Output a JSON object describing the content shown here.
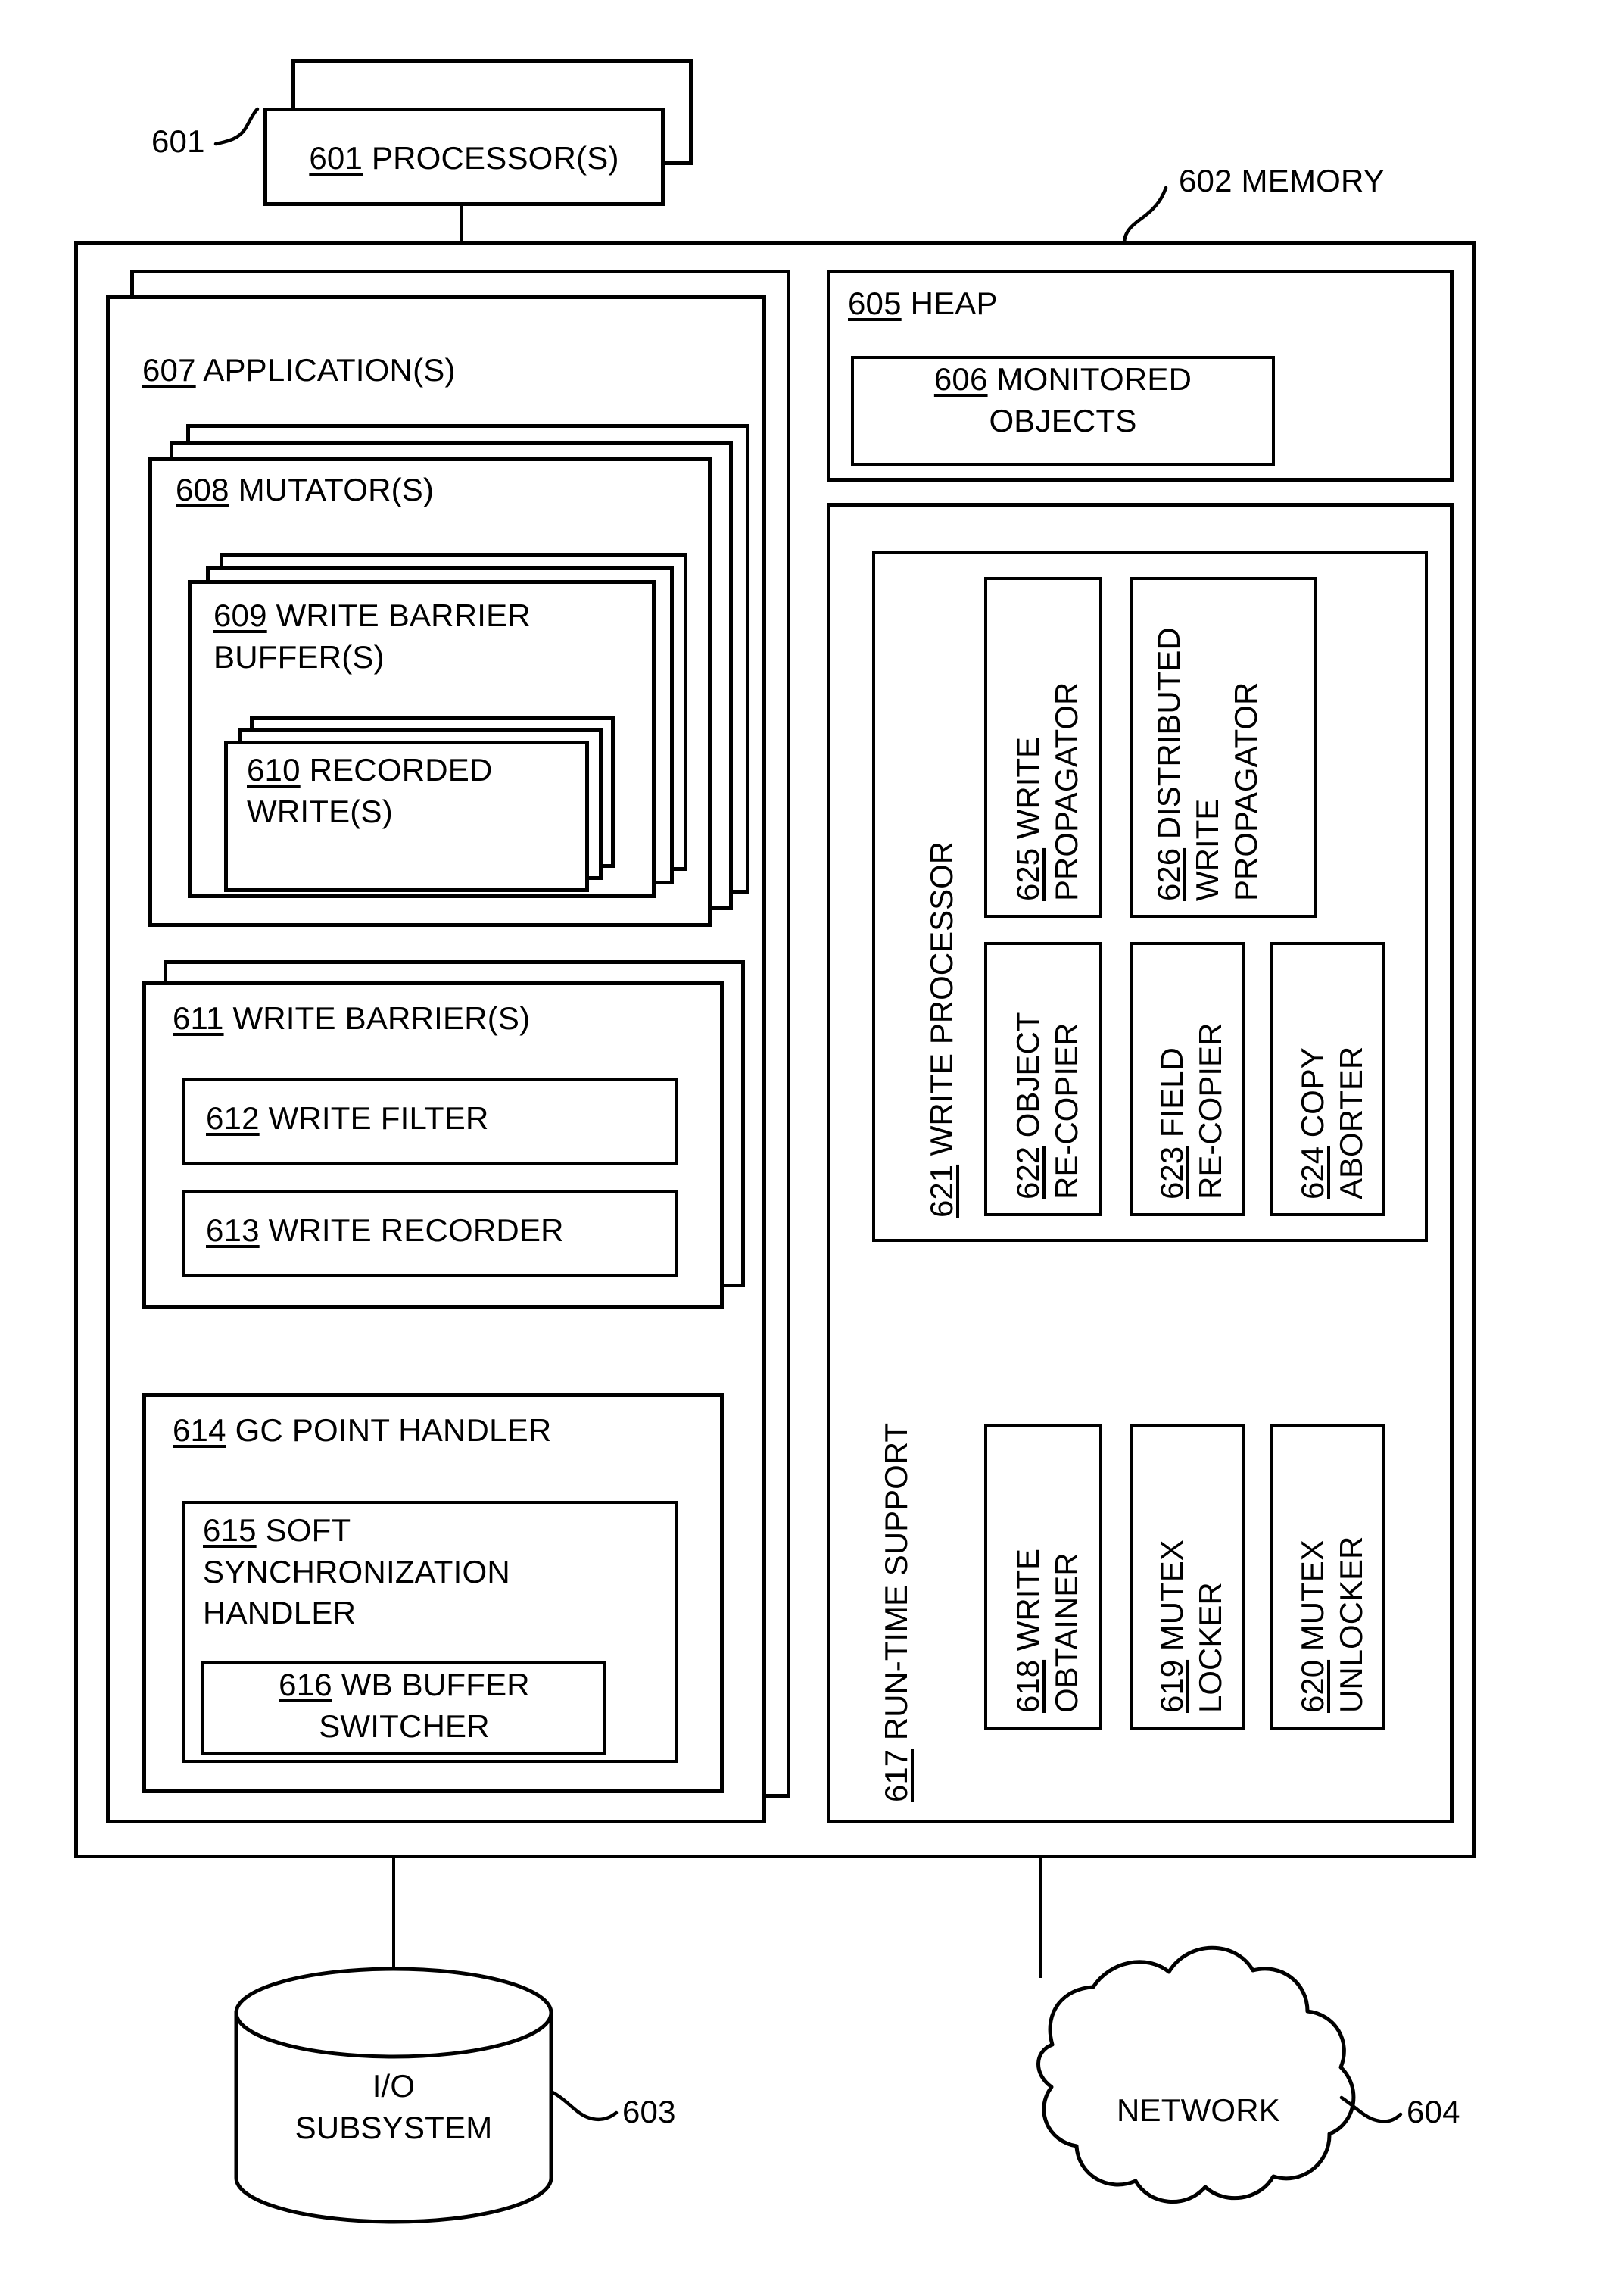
{
  "figure": {
    "type": "patent-block-diagram",
    "nodes": {
      "n601": {
        "ref": "601",
        "label": "PROCESSOR(S)"
      },
      "n602": {
        "ref": "602",
        "label": "MEMORY",
        "callout": "602 MEMORY"
      },
      "n603": {
        "ref": "603",
        "label": "I/O\nSUBSYSTEM",
        "line1": "I/O",
        "line2": "SUBSYSTEM"
      },
      "n604": {
        "ref": "604",
        "label": "NETWORK"
      },
      "n605": {
        "ref": "605",
        "label": "HEAP"
      },
      "n606": {
        "ref": "606",
        "label": "MONITORED\nOBJECTS",
        "line1": "MONITORED",
        "line2": "OBJECTS"
      },
      "n607": {
        "ref": "607",
        "label": "APPLICATION(S)"
      },
      "n608": {
        "ref": "608",
        "label": "MUTATOR(S)"
      },
      "n609": {
        "ref": "609",
        "label": "WRITE BARRIER\nBUFFER(S)",
        "line1": "WRITE BARRIER",
        "line2": "BUFFER(S)"
      },
      "n610": {
        "ref": "610",
        "label": "RECORDED\nWRITE(S)",
        "line1": "RECORDED",
        "line2": "WRITE(S)"
      },
      "n611": {
        "ref": "611",
        "label": "WRITE BARRIER(S)"
      },
      "n612": {
        "ref": "612",
        "label": "WRITE FILTER"
      },
      "n613": {
        "ref": "613",
        "label": "WRITE RECORDER"
      },
      "n614": {
        "ref": "614",
        "label": "GC POINT HANDLER"
      },
      "n615": {
        "ref": "615",
        "label": "SOFT\nSYNCHRONIZATION\nHANDLER",
        "line1": "SOFT",
        "line2": "SYNCHRONIZATION",
        "line3": "HANDLER"
      },
      "n616": {
        "ref": "616",
        "label": "WB BUFFER\nSWITCHER",
        "line1": "WB BUFFER",
        "line2": "SWITCHER"
      },
      "n617": {
        "ref": "617",
        "label": "RUN-TIME SUPPORT"
      },
      "n618": {
        "ref": "618",
        "label": "WRITE\nOBTAINER",
        "line1": "WRITE",
        "line2": "OBTAINER"
      },
      "n619": {
        "ref": "619",
        "label": "MUTEX\nLOCKER",
        "line1": "MUTEX",
        "line2": "LOCKER"
      },
      "n620": {
        "ref": "620",
        "label": "MUTEX\nUNLOCKER",
        "line1": "MUTEX",
        "line2": "UNLOCKER"
      },
      "n621": {
        "ref": "621",
        "label": "WRITE PROCESSOR"
      },
      "n622": {
        "ref": "622",
        "label": "OBJECT\nRE-COPIER",
        "line1": "OBJECT",
        "line2": "RE-COPIER"
      },
      "n623": {
        "ref": "623",
        "label": "FIELD\nRE-COPIER",
        "line1": "FIELD",
        "line2": "RE-COPIER"
      },
      "n624": {
        "ref": "624",
        "label": "COPY\nABORTER",
        "line1": "COPY",
        "line2": "ABORTER"
      },
      "n625": {
        "ref": "625",
        "label": "WRITE\nPROPAGATOR",
        "line1": "WRITE",
        "line2": "PROPAGATOR"
      },
      "n626": {
        "ref": "626",
        "label": "DISTRIBUTED\nWRITE\nPROPAGATOR",
        "line1": "DISTRIBUTED",
        "line2": "WRITE",
        "line3": "PROPAGATOR"
      }
    },
    "colors": {
      "stroke": "#000000",
      "fill": "#ffffff"
    }
  }
}
